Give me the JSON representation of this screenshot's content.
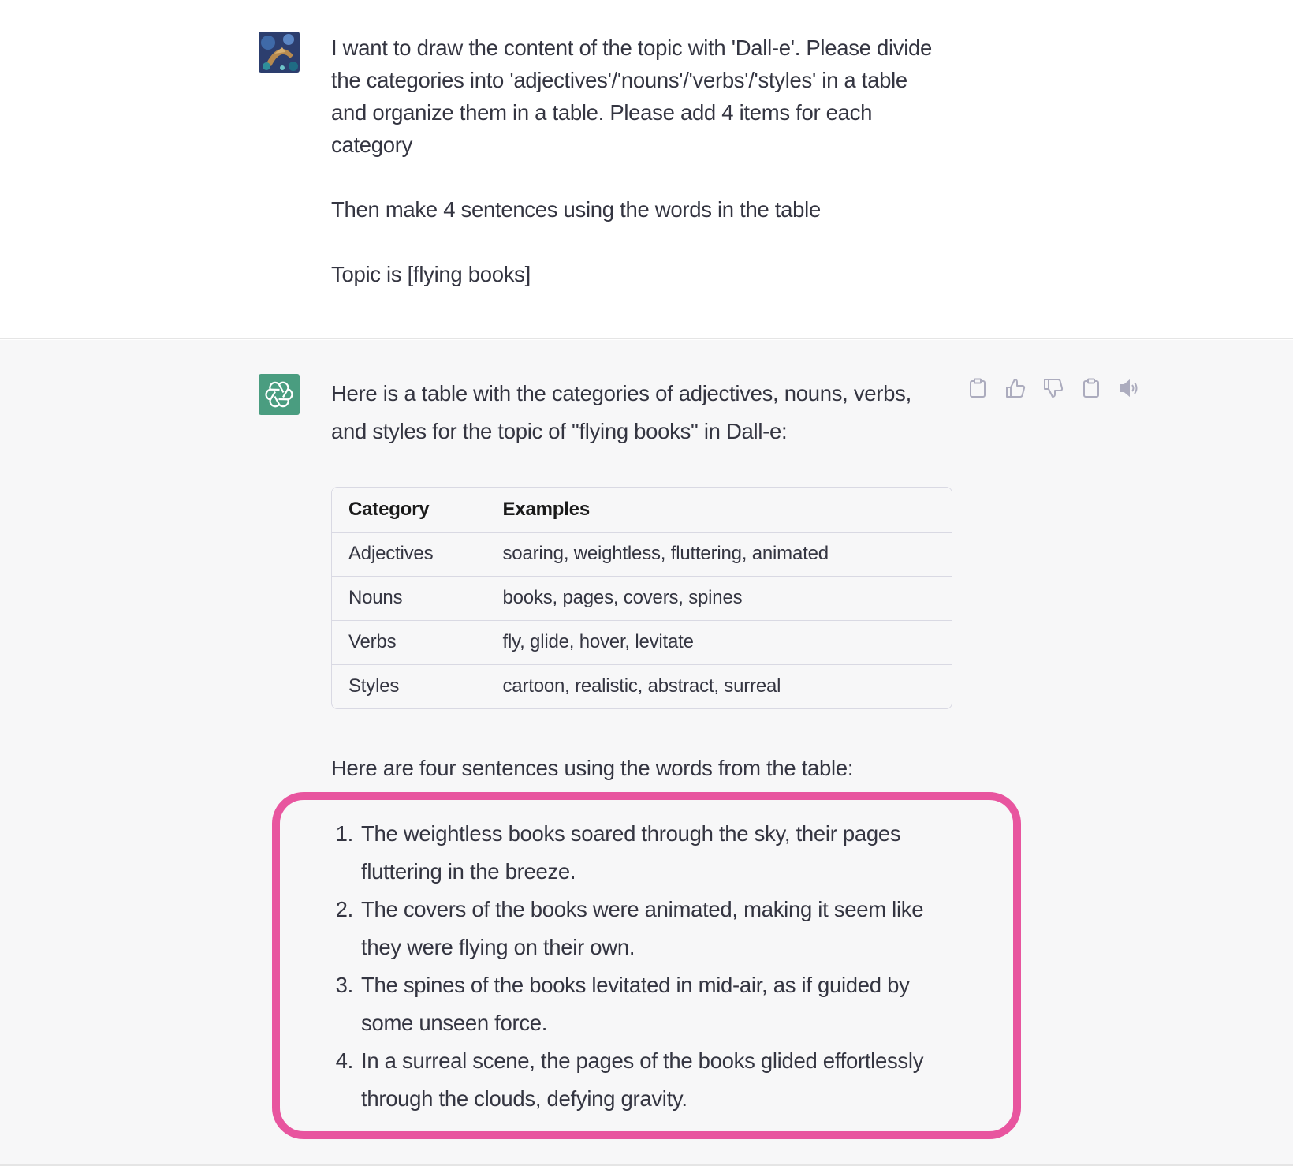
{
  "user_message": {
    "paragraphs": [
      "I want to draw the content of the topic with 'Dall-e'. Please divide the categories into 'adjectives'/'nouns'/'verbs'/'styles' in a table and organize them in a table. Please add 4 items for each category",
      "Then make 4 sentences using the words in the table",
      "Topic is [flying books]"
    ]
  },
  "assistant_message": {
    "intro": "Here is a table with the categories of adjectives, nouns, verbs, and styles for the topic of \"flying books\" in Dall-e:",
    "table": {
      "headers": [
        "Category",
        "Examples"
      ],
      "rows": [
        [
          "Adjectives",
          "soaring, weightless, fluttering, animated"
        ],
        [
          "Nouns",
          "books, pages, covers, spines"
        ],
        [
          "Verbs",
          "fly, glide, hover, levitate"
        ],
        [
          "Styles",
          "cartoon, realistic, abstract, surreal"
        ]
      ]
    },
    "outro": "Here are four sentences using the words from the table:",
    "sentences": [
      {
        "num": "1.",
        "text": "The weightless books soared through the sky, their pages fluttering in the breeze."
      },
      {
        "num": "2.",
        "text": "The covers of the books were animated, making it seem like they were flying on their own."
      },
      {
        "num": "3.",
        "text": "The spines of the books levitated in mid-air, as if guided by some unseen force."
      },
      {
        "num": "4.",
        "text": "In a surreal scene, the pages of the books glided effortlessly through the clouds, defying gravity."
      }
    ],
    "actions": [
      "copy-icon",
      "thumbs-up-icon",
      "thumbs-down-icon",
      "clipboard-icon",
      "speaker-icon"
    ]
  },
  "colors": {
    "highlight": "#e8559f",
    "bot_avatar": "#4a9d80",
    "assistant_bg": "#f7f7f8"
  }
}
